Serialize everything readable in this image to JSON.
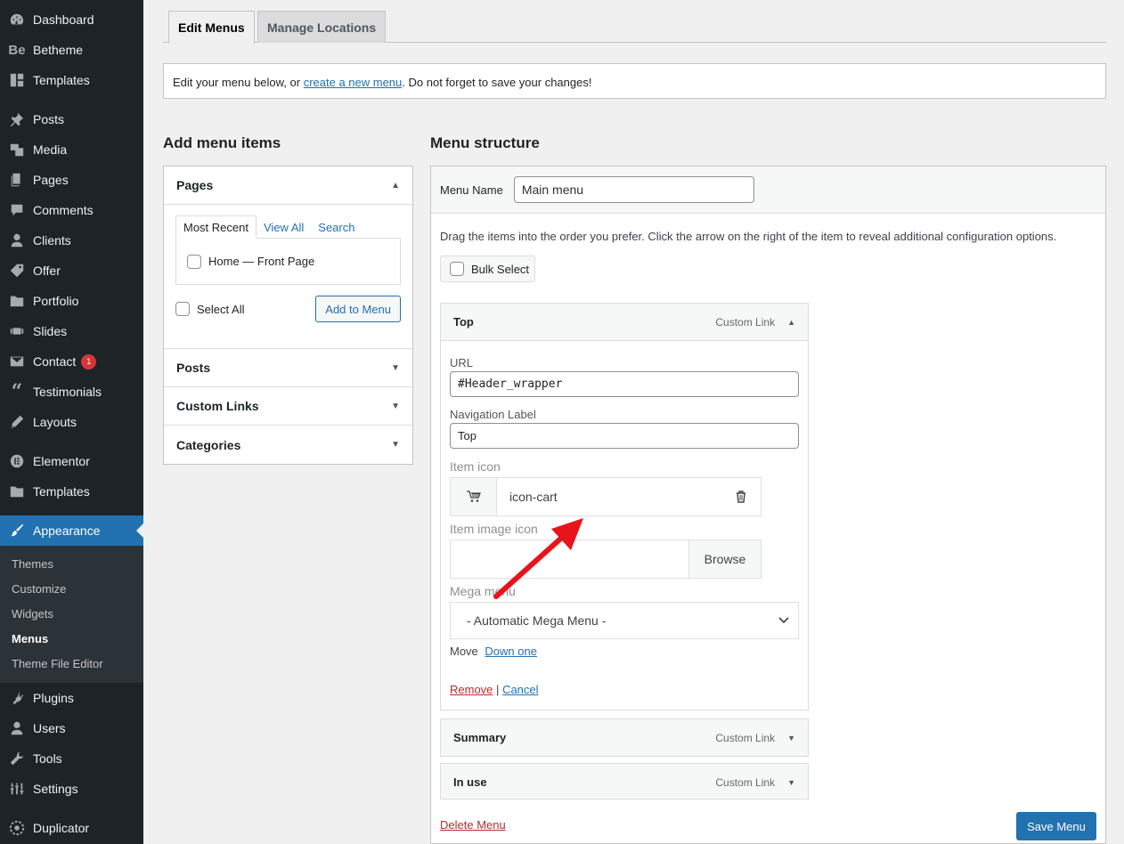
{
  "sidebar": {
    "items": [
      {
        "label": "Dashboard",
        "icon": "dashboard-icon"
      },
      {
        "label": "Betheme",
        "icon": "be-icon"
      },
      {
        "label": "Templates",
        "icon": "layout-icon"
      },
      {
        "label": "Posts",
        "icon": "pin-icon"
      },
      {
        "label": "Media",
        "icon": "media-icon"
      },
      {
        "label": "Pages",
        "icon": "pages-icon"
      },
      {
        "label": "Comments",
        "icon": "comment-icon"
      },
      {
        "label": "Clients",
        "icon": "user-icon"
      },
      {
        "label": "Offer",
        "icon": "tag-icon"
      },
      {
        "label": "Portfolio",
        "icon": "folder-icon"
      },
      {
        "label": "Slides",
        "icon": "slides-icon"
      },
      {
        "label": "Contact",
        "icon": "mail-icon",
        "badge": "1"
      },
      {
        "label": "Testimonials",
        "icon": "quote-icon"
      },
      {
        "label": "Layouts",
        "icon": "pencil-icon"
      },
      {
        "label": "Elementor",
        "icon": "elementor-icon"
      },
      {
        "label": "Templates",
        "icon": "folder-icon"
      },
      {
        "label": "Appearance",
        "icon": "brush-icon"
      },
      {
        "label": "Plugins",
        "icon": "plug-icon"
      },
      {
        "label": "Users",
        "icon": "user-icon"
      },
      {
        "label": "Tools",
        "icon": "wrench-icon"
      },
      {
        "label": "Settings",
        "icon": "settings-icon"
      },
      {
        "label": "Duplicator",
        "icon": "duplicator-icon"
      }
    ],
    "submenu": [
      "Themes",
      "Customize",
      "Widgets",
      "Menus",
      "Theme File Editor"
    ]
  },
  "tabs": {
    "edit": "Edit Menus",
    "manage": "Manage Locations"
  },
  "notice": {
    "pre": "Edit your menu below, or ",
    "link": "create a new menu",
    "post": ". Do not forget to save your changes!"
  },
  "add_items": {
    "title": "Add menu items",
    "pages_label": "Pages",
    "subtabs": [
      "Most Recent",
      "View All",
      "Search"
    ],
    "page_item": "Home — Front Page",
    "select_all": "Select All",
    "add_button": "Add to Menu",
    "sections": [
      "Posts",
      "Custom Links",
      "Categories"
    ]
  },
  "structure": {
    "title": "Menu structure",
    "name_label": "Menu Name",
    "name_value": "Main menu",
    "instructions": "Drag the items into the order you prefer. Click the arrow on the right of the item to reveal additional configuration options.",
    "bulk": "Bulk Select",
    "item": {
      "title": "Top",
      "type": "Custom Link",
      "url_label": "URL",
      "url_value": "#Header_wrapper",
      "nav_label": "Navigation Label",
      "nav_value": "Top",
      "icon_label": "Item icon",
      "icon_value": "icon-cart",
      "image_label": "Item image icon",
      "browse": "Browse",
      "mega_label": "Mega menu",
      "mega_value": "- Automatic Mega Menu -",
      "move_label": "Move",
      "move_link": "Down one",
      "remove": "Remove",
      "sep": "|",
      "cancel": "Cancel"
    },
    "others": [
      {
        "title": "Summary",
        "type": "Custom Link"
      },
      {
        "title": "In use",
        "type": "Custom Link"
      }
    ],
    "delete": "Delete Menu",
    "save": "Save Menu"
  },
  "colors": {
    "accent": "#2271b1",
    "sidebar": "#1d2327",
    "danger": "#b32d2e",
    "arrow": "#e8141b"
  }
}
